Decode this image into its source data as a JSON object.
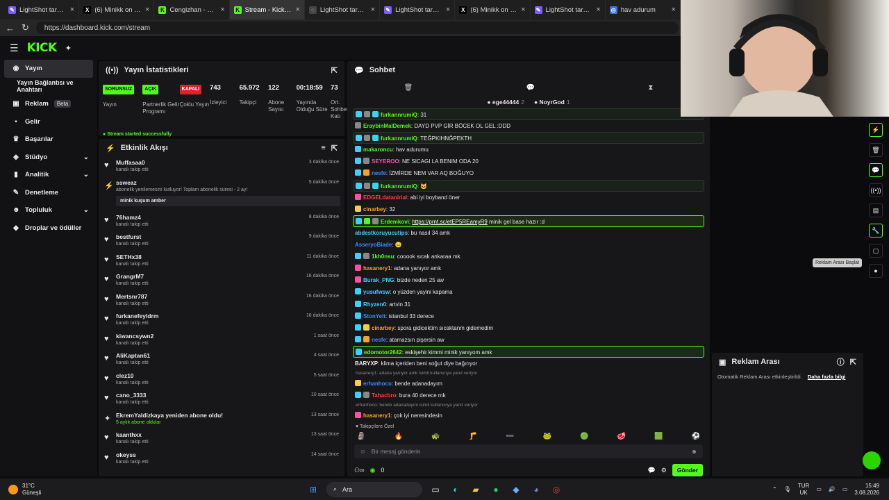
{
  "browser": {
    "tabs": [
      {
        "title": "LightShot tarafından",
        "fav": "#7b5cff",
        "sym": "✎",
        "active": false
      },
      {
        "title": "(6) Minikk on X: \"NE",
        "fav": "#000000",
        "sym": "X",
        "active": false
      },
      {
        "title": "Cengizhan - Watch c",
        "fav": "#53fc18",
        "sym": "K",
        "active": false
      },
      {
        "title": "Stream - Kick Dashb",
        "fav": "#53fc18",
        "sym": "K",
        "active": true
      },
      {
        "title": "LightShot tarafından",
        "fav": "#444444",
        "sym": "◌",
        "active": false
      },
      {
        "title": "LightShot tarafından",
        "fav": "#7b5cff",
        "sym": "✎",
        "active": false
      },
      {
        "title": "(6) Minikk on X: \"Mr",
        "fav": "#000000",
        "sym": "X",
        "active": false
      },
      {
        "title": "LightShot tarafından",
        "fav": "#7b5cff",
        "sym": "✎",
        "active": false
      },
      {
        "title": "hav adurum",
        "fav": "#3b6bff",
        "sym": "◎",
        "active": false
      }
    ],
    "url": "https://dashboard.kick.com/stream"
  },
  "brand": {
    "logo": "KICK",
    "accent": "#53fc18"
  },
  "sidebar": [
    {
      "label": "Yayın",
      "icon": "broadcast-icon",
      "glyph": "◉",
      "active": true,
      "chev": false,
      "indent": false
    },
    {
      "label": "Yayın Bağlantısı ve Anahtarı",
      "icon": "",
      "glyph": "",
      "active": false,
      "chev": false,
      "indent": true
    },
    {
      "label": "Reklam",
      "icon": "ad-icon",
      "glyph": "▣",
      "active": false,
      "chev": false,
      "beta": "Beta"
    },
    {
      "label": "Gelir",
      "icon": "revenue-icon",
      "glyph": "▪",
      "active": false,
      "chev": false
    },
    {
      "label": "Başarılar",
      "icon": "trophy-icon",
      "glyph": "♛",
      "active": false,
      "chev": false
    },
    {
      "label": "Stüdyo",
      "icon": "studio-icon",
      "glyph": "◈",
      "active": false,
      "chev": true
    },
    {
      "label": "Analitik",
      "icon": "analytics-icon",
      "glyph": "▮",
      "active": false,
      "chev": true
    },
    {
      "label": "Denetleme",
      "icon": "moderation-icon",
      "glyph": "✎",
      "active": false,
      "chev": false
    },
    {
      "label": "Topluluk",
      "icon": "community-icon",
      "glyph": "☻",
      "active": false,
      "chev": true
    },
    {
      "label": "Droplar ve ödüller",
      "icon": "drops-icon",
      "glyph": "◆",
      "active": false,
      "chev": false
    }
  ],
  "stats": {
    "title": "Yayın İstatistikleri",
    "items": [
      {
        "badge": "SORUNSUZ",
        "badgeColor": "#53fc18",
        "value": "",
        "label": "Yayın",
        "w": 58
      },
      {
        "badge": "AÇIK",
        "badgeColor": "#53fc18",
        "value": "",
        "label": "Partnerlik Gelir Programı",
        "w": 54
      },
      {
        "badge": "KAPALI",
        "badgeColor": "#e2202c",
        "value": "",
        "label": "Çoklu Yayın",
        "w": 44
      },
      {
        "badge": "",
        "value": "743",
        "label": "İzleyici",
        "w": 43
      },
      {
        "badge": "",
        "value": "65.972",
        "label": "Takipçi",
        "w": 42
      },
      {
        "badge": "",
        "value": "122",
        "label": "Abone Sayısı",
        "w": 41
      },
      {
        "badge": "",
        "value": "00:18:59",
        "label": "Yayında Olduğu Süre",
        "w": 50
      },
      {
        "badge": "",
        "value": "73",
        "label": "Ort. Sohbet Katı",
        "w": 20
      }
    ],
    "notice": "Stream started successfully"
  },
  "activity": {
    "title": "Etkinlik Akışı",
    "items": [
      {
        "name": "Muffasaa0",
        "sub": "kanalı takip etti",
        "time": "3 dakika önce",
        "icon": "heart"
      },
      {
        "name": "ssweaz",
        "sub": "abonelik yenilemesini kutluyor! Toplam abonelik süresi - 2 ay!",
        "time": "5 dakika önce",
        "icon": "sub",
        "msg": "minik kuşum amber"
      },
      {
        "name": "76hamz4",
        "sub": "kanalı takip etti",
        "time": "8 dakika önce",
        "icon": "heart"
      },
      {
        "name": "bestfurst",
        "sub": "kanalı takip etti",
        "time": "9 dakika önce",
        "icon": "heart"
      },
      {
        "name": "SETHx38",
        "sub": "kanalı takip etti",
        "time": "11 dakika önce",
        "icon": "heart"
      },
      {
        "name": "GrangrM7",
        "sub": "kanalı takip etti",
        "time": "16 dakika önce",
        "icon": "heart"
      },
      {
        "name": "Mertsnr787",
        "sub": "kanalı takip etti",
        "time": "16 dakika önce",
        "icon": "heart"
      },
      {
        "name": "furkanefeyldrm",
        "sub": "kanalı takip etti",
        "time": "16 dakika önce",
        "icon": "heart"
      },
      {
        "name": "kiwancsywn2",
        "sub": "kanalı takip etti",
        "time": "1 saat önce",
        "icon": "heart"
      },
      {
        "name": "AliKaptan61",
        "sub": "kanalı takip etti",
        "time": "4 saat önce",
        "icon": "heart"
      },
      {
        "name": "clez10",
        "sub": "kanalı takip etti",
        "time": "5 saat önce",
        "icon": "heart"
      },
      {
        "name": "cano_3333",
        "sub": "kanalı takip etti",
        "time": "10 saat önce",
        "icon": "heart"
      },
      {
        "name": "EkremYaldizkaya yeniden abone oldu!",
        "sub": "5 aylık abone oldular",
        "time": "13 saat önce",
        "icon": "star"
      },
      {
        "name": "kaanthxx",
        "sub": "kanalı takip etti",
        "time": "13 saat önce",
        "icon": "heart"
      },
      {
        "name": "okeyss",
        "sub": "kanalı takip etti",
        "time": "14 saat önce",
        "icon": "heart"
      }
    ]
  },
  "chat": {
    "title": "Sohbet",
    "pinned": [
      {
        "name": "ege44444",
        "count": "2"
      },
      {
        "name": "NoyrGod",
        "count": "1"
      }
    ],
    "messages": [
      {
        "user": "furkannrumiQ",
        "color": "#53fc18",
        "text": "31",
        "badges": [
          "#3ad1ff",
          "#888",
          "#3ad1ff"
        ],
        "style": "gl"
      },
      {
        "user": "EraybinMalDemek",
        "color": "#53fc18",
        "text": "DAYD PVP GİR BÖCEK OL GEL :DDD",
        "badges": [
          "#888"
        ]
      },
      {
        "user": "furkannrumiQ",
        "color": "#53fc18",
        "text": "TEĞPKIHNĞPEKTH",
        "badges": [
          "#3ad1ff",
          "#888",
          "#3ad1ff"
        ],
        "style": "gl"
      },
      {
        "user": "makaroncu",
        "color": "#53fc18",
        "text": "hav adurumu",
        "badges": [
          "#3ad1ff"
        ]
      },
      {
        "user": "SEYEROO",
        "color": "#ff4fa3",
        "text": "NE SICAGI LA BENIM ODA 20",
        "badges": [
          "#3ad1ff",
          "#888"
        ]
      },
      {
        "user": "nesfe",
        "color": "#3a8bff",
        "text": "İZMİRDE NEM VAR AQ BOĞUYO",
        "badges": [
          "#3ad1ff",
          "#f5a623"
        ]
      },
      {
        "user": "furkannrumiQ",
        "color": "#53fc18",
        "text": "🐱",
        "badges": [
          "#3ad1ff",
          "#888",
          "#3ad1ff"
        ],
        "style": "gl"
      },
      {
        "user": "EDGELdatanirial",
        "color": "#ff4040",
        "text": "abi iyi boyband öner",
        "badges": [
          "#ff4fa3"
        ]
      },
      {
        "user": "cinarbey",
        "color": "#f5a623",
        "text": "32",
        "badges": [
          "#f5d142"
        ]
      },
      {
        "user": "Erdemkovi",
        "color": "#53fc18",
        "text": "minik gel base hazır :d",
        "link": "https://prnt.sc/etEP5REamyR9",
        "badges": [
          "#3ad1ff",
          "#53fc18",
          "#888"
        ],
        "style": "hl"
      },
      {
        "user": "abdestkoruyucutips",
        "color": "#3ad1ff",
        "text": "bu nasıl 34 amk",
        "badges": []
      },
      {
        "user": "AsseryoBiade",
        "color": "#3a8bff",
        "text": "😐",
        "badges": []
      },
      {
        "user": "1kh0nsu",
        "color": "#53fc18",
        "text": "cooook sıcak ankaraa mk",
        "badges": [
          "#3ad1ff",
          "#888"
        ]
      },
      {
        "user": "hasanery1",
        "color": "#f5a623",
        "text": "adana yanıyor amk",
        "badges": [
          "#ff4fa3"
        ]
      },
      {
        "user": "Burak_PNG",
        "color": "#3ad1ff",
        "text": "bizde neden 25 aw",
        "badges": [
          "#ff4fa3"
        ]
      },
      {
        "user": "yusufwsw",
        "color": "#3ad1ff",
        "text": "o yüzden yayini kapama",
        "badges": [
          "#3ad1ff"
        ]
      },
      {
        "user": "Rhyzen0",
        "color": "#3ad1ff",
        "text": "artvin 31",
        "badges": [
          "#3ad1ff"
        ]
      },
      {
        "user": "StonYelt",
        "color": "#3a8bff",
        "text": "istanbul 33 derece",
        "badges": [
          "#3ad1ff"
        ]
      },
      {
        "user": "cinarbey",
        "color": "#f5a623",
        "text": "spora gidicektim sıcaktanm gidemedim",
        "badges": [
          "#3ad1ff",
          "#f5d142"
        ]
      },
      {
        "user": "nesfe",
        "color": "#3a8bff",
        "text": "atamazsın pişersin aw",
        "badges": [
          "#3ad1ff",
          "#f5a623"
        ]
      },
      {
        "user": "edomotor2642",
        "color": "#53fc18",
        "text": "eskişehir kimmi minik yanıyom amk",
        "badges": [
          "#3ad1ff"
        ],
        "style": "hl"
      },
      {
        "user": "BARYXP",
        "color": "#e8e8e8",
        "text": "klima içeriden beni soğut diye bağırıyor",
        "badges": []
      },
      {
        "reply": "hasanery1: adana yanıyor amk isimli kullanıcıya yanıt veriyor"
      },
      {
        "user": "erhanhoco",
        "color": "#3a8bff",
        "text": "bende adanadayım",
        "badges": [
          "#f5d142"
        ]
      },
      {
        "user": "Tahacbro",
        "color": "#ff4040",
        "text": "bura 40 derece mk",
        "badges": [
          "#3ad1ff",
          "#888"
        ]
      },
      {
        "reply": "erhanhoco: bende adanadayım isimli kullanıcıya yanıt veriyor"
      },
      {
        "user": "hasanery1",
        "color": "#f5a623",
        "text": "çok iyi neresindesin",
        "badges": [
          "#ff4fa3"
        ]
      }
    ],
    "followers_label": "Takipçilere Özel",
    "emotes": [
      "🗿",
      "🔥",
      "🐢",
      "🦵",
      "➖",
      "🐸",
      "🟢",
      "🥩",
      "🟩",
      "⚽"
    ],
    "input_placeholder": "Bir mesaj gönderin",
    "points": "0",
    "send_label": "Gönder"
  },
  "right": {
    "tooltip": "Reklam Arası Başlat",
    "tools": [
      "⚡",
      "🗑",
      "💬",
      "((•))",
      "▤",
      "🔧",
      "▢",
      "●"
    ]
  },
  "ad_break": {
    "title": "Reklam Arası",
    "text": "Otomatik Reklam Arası etkinleştirildi.",
    "link": "Daha fazla bilgi"
  },
  "taskbar": {
    "weather_temp": "31°C",
    "weather_desc": "Güneşli",
    "search": "Ara",
    "lang1": "TUR",
    "lang2": "UK",
    "time": "15:49",
    "date": "3.08.2026"
  }
}
